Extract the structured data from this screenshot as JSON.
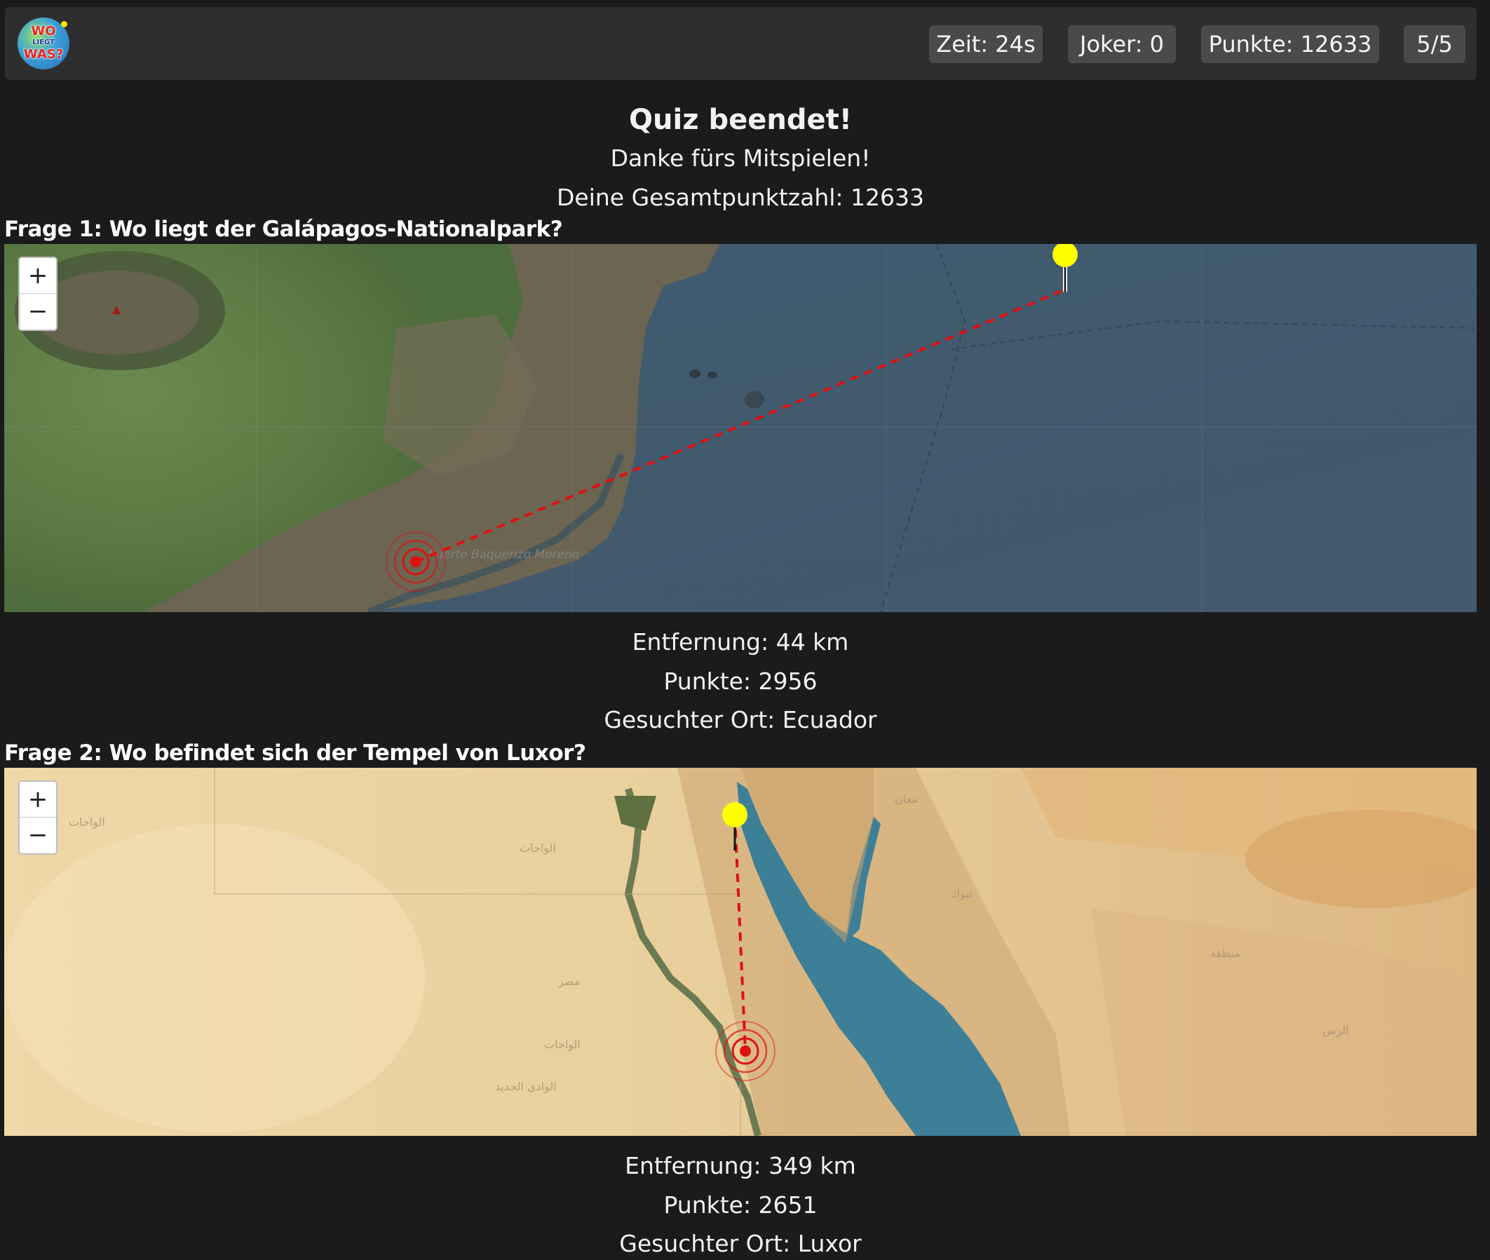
{
  "header": {
    "logo": {
      "line1": "WO",
      "line2": "LIEGT",
      "line3": "WAS?"
    },
    "time": "Zeit: 24s",
    "joker": "Joker: 0",
    "points": "Punkte: 12633",
    "progress": "5/5"
  },
  "result": {
    "title": "Quiz beendet!",
    "thanks": "Danke fürs Mitspielen!",
    "total": "Deine Gesamtpunktzahl: 12633"
  },
  "questions": [
    {
      "title": "Frage 1: Wo liegt der Galápagos-Nationalpark?",
      "distance": "Entfernung: 44 km",
      "points": "Punkte: 2956",
      "place": "Gesuchter Ort: Ecuador",
      "map_label": "Puerto Baquerizo Moreno"
    },
    {
      "title": "Frage 2: Wo befindet sich der Tempel von Luxor?",
      "distance": "Entfernung: 349 km",
      "points": "Punkte: 2651",
      "place": "Gesuchter Ort: Luxor"
    }
  ],
  "map_controls": {
    "zoom_in": "+",
    "zoom_out": "−"
  },
  "colors": {
    "guess_pin": "#ffff00",
    "target_marker": "#e01010",
    "distance_line": "#e01010"
  }
}
